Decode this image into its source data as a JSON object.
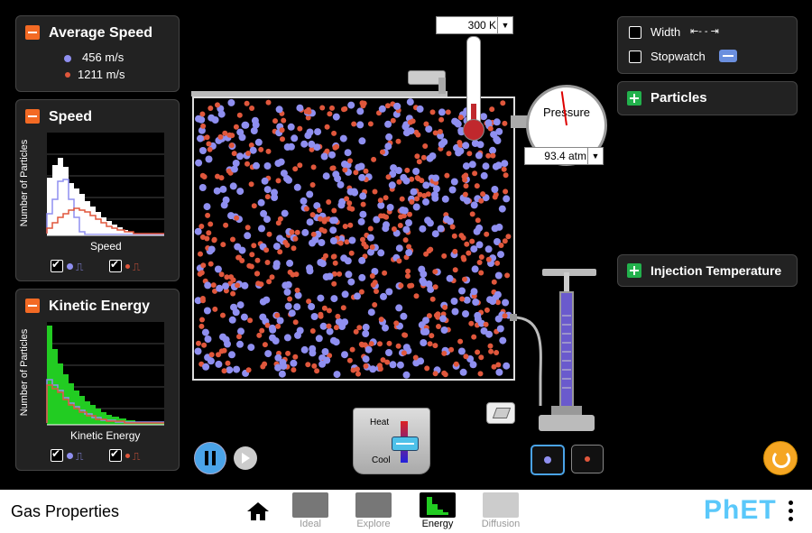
{
  "average_speed": {
    "title": "Average Speed",
    "heavy_value": "456 m/s",
    "light_value": "1211 m/s"
  },
  "speed_panel": {
    "title": "Speed",
    "ylabel": "Number of Particles",
    "xlabel": "Speed"
  },
  "ke_panel": {
    "title": "Kinetic Energy",
    "ylabel": "Number of Particles",
    "xlabel": "Kinetic Energy"
  },
  "thermometer": {
    "value": "300 K"
  },
  "pressure": {
    "label": "Pressure",
    "value": "93.4 atm"
  },
  "heater": {
    "heat_label": "Heat",
    "cool_label": "Cool"
  },
  "right_panel": {
    "width_label": "Width",
    "stopwatch_label": "Stopwatch",
    "particles_label": "Particles",
    "injection_label": "Injection Temperature"
  },
  "navbar": {
    "sim_title": "Gas Properties",
    "tabs": [
      "Ideal",
      "Explore",
      "Energy",
      "Diffusion"
    ],
    "selected_tab": "Energy"
  },
  "colors": {
    "heavy": "#8f8ff0",
    "light": "#e0573c",
    "accent_orange": "#f36a24",
    "plus_green": "#22b14c",
    "ke_green": "#22cc22"
  },
  "icons": [
    "minus-icon",
    "plus-icon",
    "home-icon",
    "reset-icon",
    "pause-icon",
    "step-icon",
    "eraser-icon",
    "kebab-menu-icon"
  ]
}
